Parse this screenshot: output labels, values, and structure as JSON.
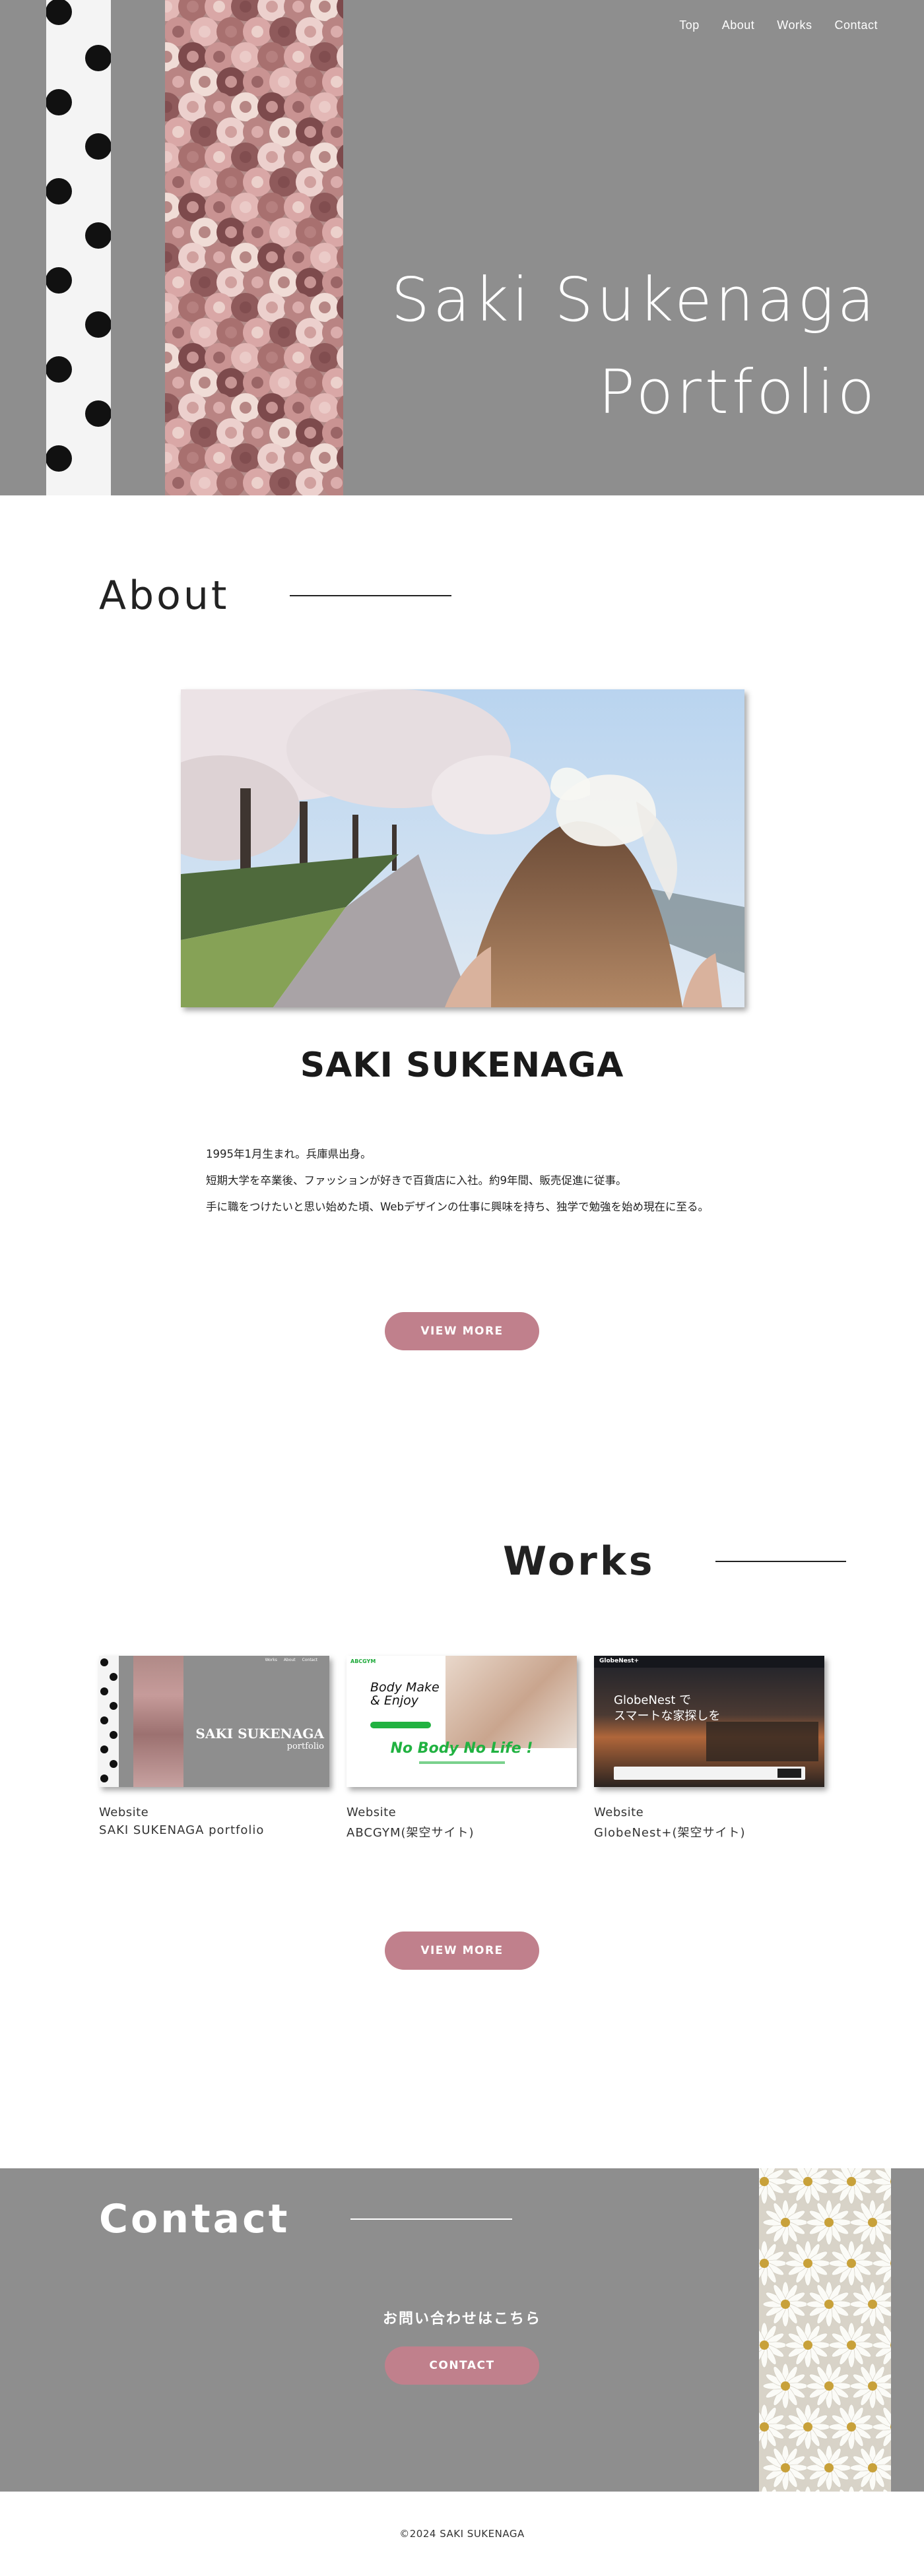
{
  "nav": {
    "items": [
      "Top",
      "About",
      "Works",
      "Contact"
    ]
  },
  "hero": {
    "title_line1": "Saki Sukenaga",
    "title_line2": "Portfolio"
  },
  "about": {
    "heading": "About",
    "name": "SAKI SUKENAGA",
    "paragraphs": [
      "1995年1月生まれ。兵庫県出身。",
      "短期大学を卒業後、ファッションが好きで百貨店に入社。約9年間、販売促進に従事。",
      "手に職をつけたいと思い始めた頃、Webデザインの仕事に興味を持ち、独学で勉強を始め現在に至る。"
    ],
    "button": "VIEW MORE"
  },
  "works": {
    "heading": "Works",
    "items": [
      {
        "category": "Website",
        "title": "SAKI SUKENAGA portfolio",
        "thumb": {
          "title": "SAKI SUKENAGA",
          "subtitle": "portfolio",
          "nav": [
            "Works",
            "About",
            "Contact"
          ]
        }
      },
      {
        "category": "Website",
        "title": "ABCGYM(架空サイト)",
        "thumb": {
          "logo": "ABCGYM",
          "headline1": "Body Make",
          "headline2": "& Enjoy",
          "tagline": "No Body No Life !"
        }
      },
      {
        "category": "Website",
        "title": "GlobeNest+(架空サイト)",
        "thumb": {
          "logo": "GlobeNest+",
          "headline1": "GlobeNest で",
          "headline2": "スマートな家探しを"
        }
      }
    ],
    "button": "VIEW MORE"
  },
  "contact": {
    "heading": "Contact",
    "lead": "お問い合わせはこちら",
    "button": "CONTACT"
  },
  "footer": {
    "copyright": "©2024 SAKI SUKENAGA"
  },
  "colors": {
    "hero_bg": "#8e8e8e",
    "accent_pink": "#c0808c",
    "text_dark": "#222222"
  }
}
